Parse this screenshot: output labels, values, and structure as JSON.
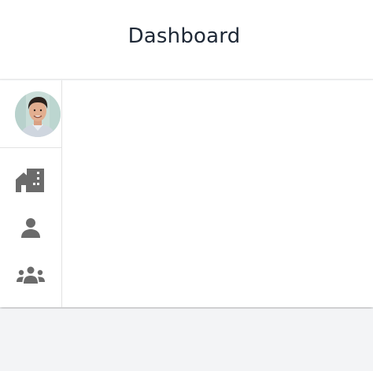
{
  "header": {
    "title": "Dashboard"
  },
  "sidebar": {
    "avatar_icon": "user-profile-avatar",
    "items": [
      {
        "name": "buildings",
        "icon": "buildings-icon"
      },
      {
        "name": "user",
        "icon": "person-icon"
      },
      {
        "name": "team",
        "icon": "people-group-icon"
      }
    ]
  },
  "colors": {
    "background": "#f3f4f6",
    "surface": "#ffffff",
    "icon": "#6b6b6b",
    "title_text": "#1f2937",
    "divider": "#e2e2e2"
  }
}
